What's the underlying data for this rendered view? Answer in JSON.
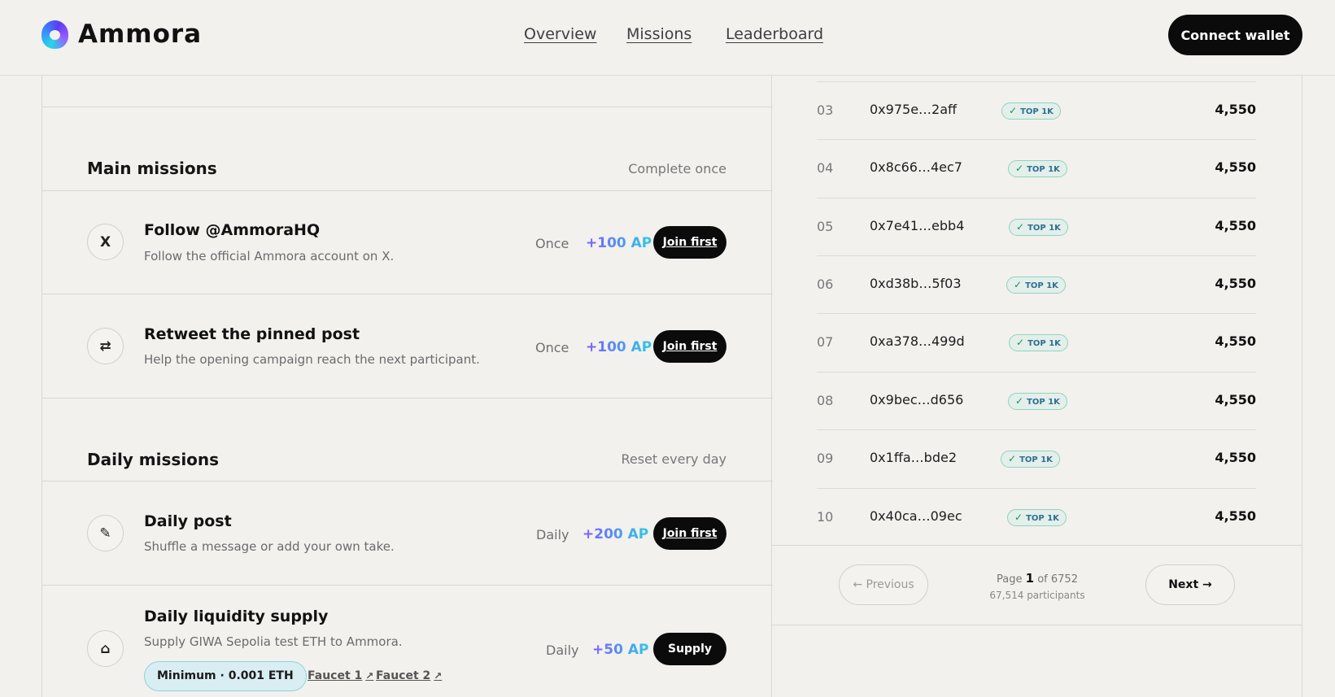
{
  "brand": {
    "name": "Ammora"
  },
  "nav": {
    "items": [
      "Overview",
      "Missions",
      "Leaderboard"
    ]
  },
  "header": {
    "connect_label": "Connect wallet"
  },
  "main_missions": {
    "title": "Main missions",
    "note": "Complete once",
    "items": [
      {
        "icon": "x-icon",
        "glyph": "X",
        "title": "Follow @AmmoraHQ",
        "desc": "Follow the official Ammora account on X.",
        "freq": "Once",
        "points": "+100 AP",
        "action": "Join first"
      },
      {
        "icon": "retweet-icon",
        "glyph": "⇄",
        "title": "Retweet the pinned post",
        "desc": "Help the opening campaign reach the next participant.",
        "freq": "Once",
        "points": "+100 AP",
        "action": "Join first"
      }
    ]
  },
  "daily_missions": {
    "title": "Daily missions",
    "note": "Reset every day",
    "items": [
      {
        "icon": "pencil-icon",
        "glyph": "✎",
        "title": "Daily post",
        "desc": "Shuffle a message or add your own take.",
        "freq": "Daily",
        "points": "+200 AP",
        "action": "Join first"
      },
      {
        "icon": "bank-icon",
        "glyph": "⌂",
        "title": "Daily liquidity supply",
        "desc": "Supply GIWA Sepolia test ETH to Ammora.",
        "freq": "Daily",
        "points": "+50 AP",
        "action": "Supply",
        "minimum": "Minimum · 0.001 ETH",
        "faucets": [
          "Faucet 1",
          "Faucet 2"
        ]
      }
    ]
  },
  "leaderboard": {
    "badge": "TOP 1K",
    "rows": [
      {
        "rank": "03",
        "address": "0x975e…2aff",
        "score": "4,550"
      },
      {
        "rank": "04",
        "address": "0x8c66…4ec7",
        "score": "4,550"
      },
      {
        "rank": "05",
        "address": "0x7e41…ebb4",
        "score": "4,550"
      },
      {
        "rank": "06",
        "address": "0xd38b…5f03",
        "score": "4,550"
      },
      {
        "rank": "07",
        "address": "0xa378…499d",
        "score": "4,550"
      },
      {
        "rank": "08",
        "address": "0x9bec…d656",
        "score": "4,550"
      },
      {
        "rank": "09",
        "address": "0x1ffa…bde2",
        "score": "4,550"
      },
      {
        "rank": "10",
        "address": "0x40ca…09ec",
        "score": "4,550"
      }
    ],
    "pager": {
      "prev": "← Previous",
      "next": "Next →",
      "page_prefix": "Page",
      "page": "1",
      "page_suffix": "of 6752",
      "participants": "67,514 participants"
    }
  }
}
